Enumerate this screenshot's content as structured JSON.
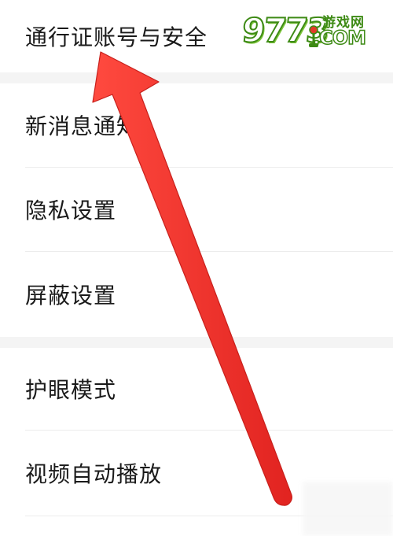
{
  "watermark": {
    "digits": "9773",
    "site_name": "游戏网",
    "domain": ".COM",
    "brand_color": "#3d8a14"
  },
  "settings": {
    "items": [
      {
        "label": "通行证账号与安全"
      },
      {
        "label": "新消息通知"
      },
      {
        "label": "隐私设置"
      },
      {
        "label": "屏蔽设置"
      },
      {
        "label": "护眼模式"
      },
      {
        "label": "视频自动播放"
      }
    ]
  },
  "annotation": {
    "arrow_color": "#f0302c",
    "points_to": "通行证账号与安全"
  }
}
